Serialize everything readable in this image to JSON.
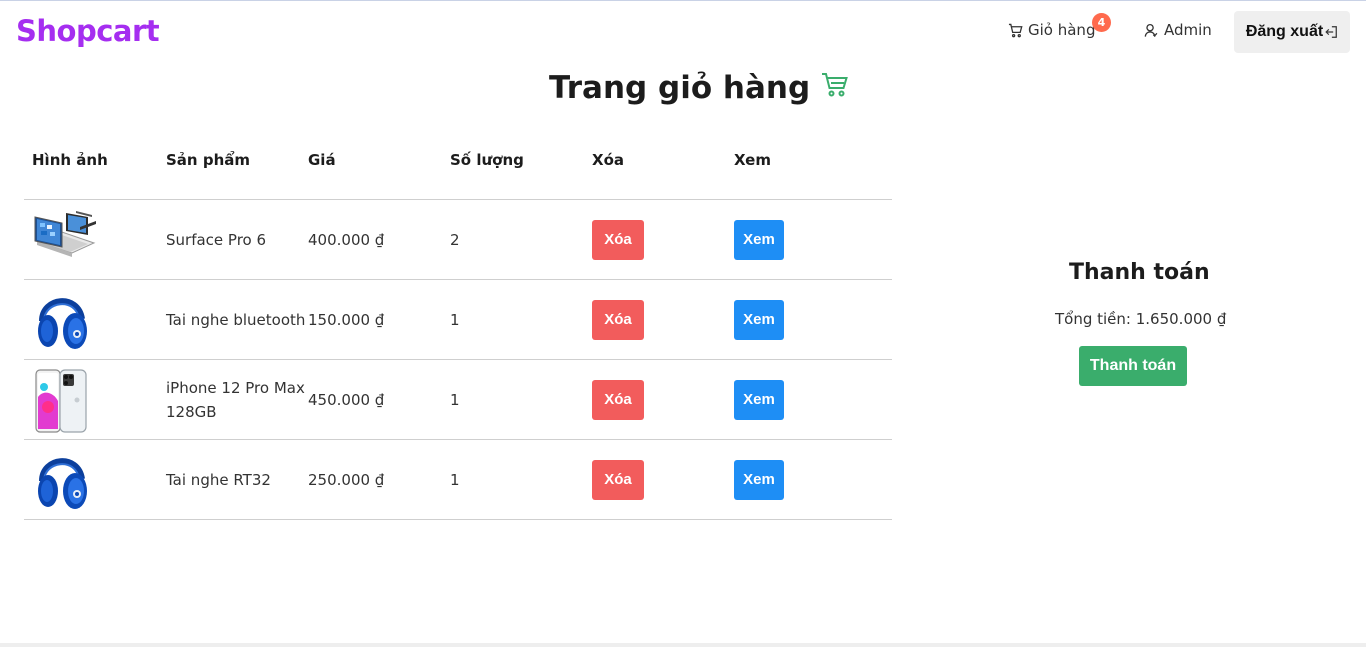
{
  "header": {
    "logo": "Shopcart",
    "cart_label": "Giỏ hàng",
    "cart_count": "4",
    "user_label": "Admin",
    "logout_label": "Đăng xuất",
    "icons": [
      "cart-icon",
      "user-icon",
      "logout-icon"
    ]
  },
  "page": {
    "title": "Trang giỏ hàng",
    "title_icon": "cart-icon",
    "accent_color": "#3aad6c"
  },
  "table": {
    "headers": [
      "Hình ảnh",
      "Sản phẩm",
      "Giá",
      "Số lượng",
      "Xóa",
      "Xem"
    ],
    "rows": [
      {
        "image": "laptop-image",
        "product": "Surface Pro 6",
        "price": "400.000 ₫",
        "quantity": "2",
        "delete_label": "Xóa",
        "view_label": "Xem"
      },
      {
        "image": "headphones-image",
        "product": "Tai nghe bluetooth",
        "price": "150.000 ₫",
        "quantity": "1",
        "delete_label": "Xóa",
        "view_label": "Xem"
      },
      {
        "image": "phone-image",
        "product": "iPhone 12 Pro Max 128GB",
        "price": "450.000 ₫",
        "quantity": "1",
        "delete_label": "Xóa",
        "view_label": "Xem"
      },
      {
        "image": "headphones-image",
        "product": "Tai nghe RT32",
        "price": "250.000 ₫",
        "quantity": "1",
        "delete_label": "Xóa",
        "view_label": "Xem"
      }
    ]
  },
  "checkout": {
    "title": "Thanh toán",
    "total": "Tổng tiền: 1.650.000 ₫",
    "button_label": "Thanh toán"
  },
  "colors": {
    "logo": "#a52ef0",
    "badge": "#ff6a4d",
    "delete": "#f25c5c",
    "view": "#1e8ef5",
    "pay": "#3aad6c"
  }
}
